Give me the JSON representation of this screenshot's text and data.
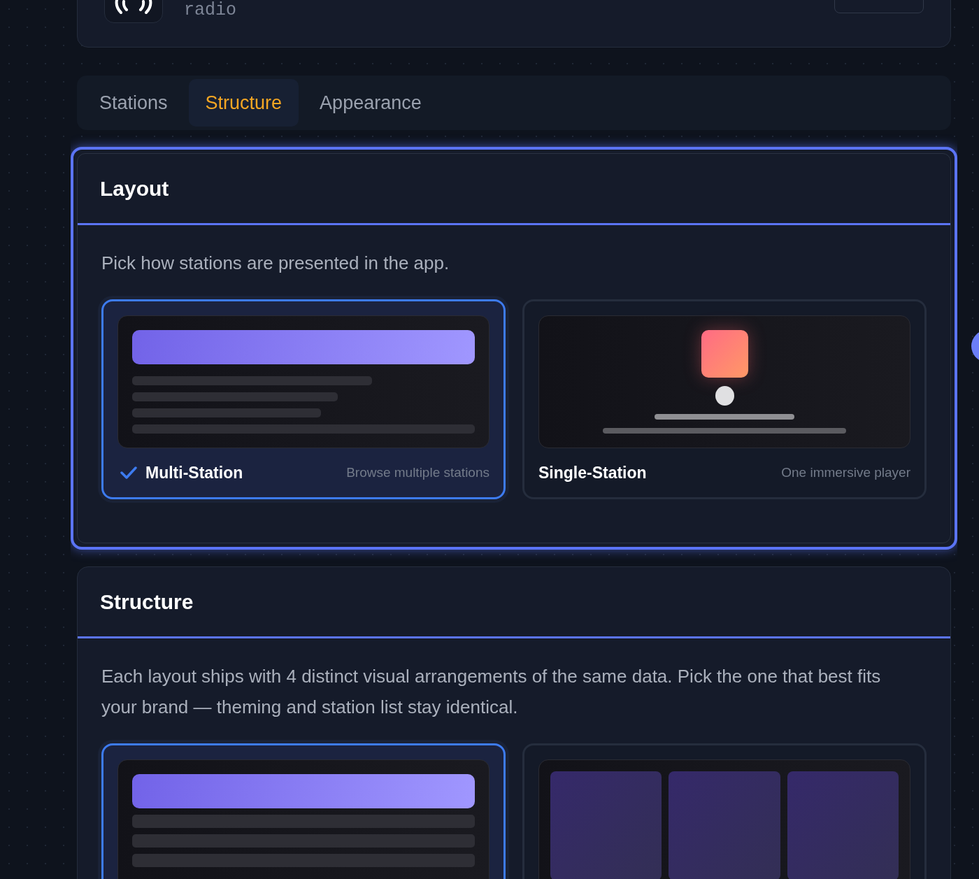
{
  "header": {
    "subtitle": "radio"
  },
  "tabs": [
    {
      "label": "Stations",
      "selected": false
    },
    {
      "label": "Structure",
      "selected": true
    },
    {
      "label": "Appearance",
      "selected": false
    }
  ],
  "sections": [
    {
      "title": "Layout",
      "highlighted": true,
      "description": "Pick how stations are presented in the app.",
      "options": [
        {
          "kind": "list",
          "title": "Multi-Station",
          "caption": "Browse multiple stations",
          "selected": true
        },
        {
          "kind": "player",
          "title": "Single-Station",
          "caption": "One immersive player",
          "selected": false
        }
      ]
    },
    {
      "title": "Structure",
      "highlighted": false,
      "description": "Each layout ships with 4 distinct visual arrangements of the same data. Pick the one that best fits your brand — theming and station list stay identical.",
      "options": [
        {
          "kind": "list-compact",
          "selected": true
        },
        {
          "kind": "grid",
          "selected": false
        }
      ]
    }
  ]
}
